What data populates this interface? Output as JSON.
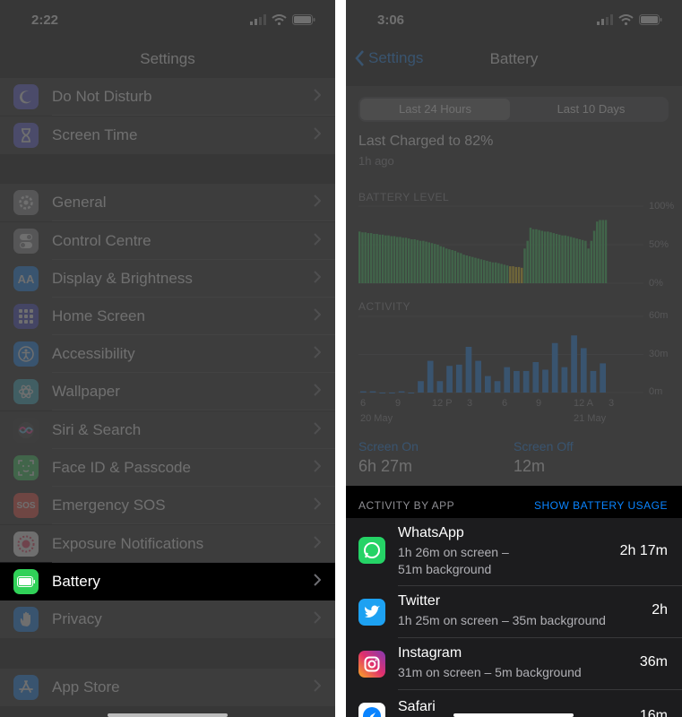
{
  "left": {
    "status_time": "2:22",
    "nav_title": "Settings",
    "items": [
      {
        "label": "Do Not Disturb",
        "icon": "moon-icon",
        "color": "#5e5ce6"
      },
      {
        "label": "Screen Time",
        "icon": "hourglass-icon",
        "color": "#5e5ce6"
      },
      {
        "label": "General",
        "icon": "gear-icon",
        "color": "#8e8e93"
      },
      {
        "label": "Control Centre",
        "icon": "toggles-icon",
        "color": "#8e8e93"
      },
      {
        "label": "Display & Brightness",
        "icon": "text-size-icon",
        "color": "#0a84ff",
        "glyph": "AA"
      },
      {
        "label": "Home Screen",
        "icon": "app-grid-icon",
        "color": "#3d3fce"
      },
      {
        "label": "Accessibility",
        "icon": "accessibility-icon",
        "color": "#0a84ff"
      },
      {
        "label": "Wallpaper",
        "icon": "flower-icon",
        "color": "#30b0c7"
      },
      {
        "label": "Siri & Search",
        "icon": "siri-icon",
        "color": "#222222"
      },
      {
        "label": "Face ID & Passcode",
        "icon": "face-id-icon",
        "color": "#30d158"
      },
      {
        "label": "Emergency SOS",
        "icon": "sos-icon",
        "color": "#ff453a",
        "glyph": "SOS"
      },
      {
        "label": "Exposure Notifications",
        "icon": "exposure-icon",
        "color": "#ffffff"
      },
      {
        "label": "Battery",
        "icon": "battery-icon",
        "color": "#30d158"
      },
      {
        "label": "Privacy",
        "icon": "hand-icon",
        "color": "#0a84ff"
      },
      {
        "label": "App Store",
        "icon": "app-store-icon",
        "color": "#0a84ff"
      }
    ]
  },
  "right": {
    "status_time": "3:06",
    "back_label": "Settings",
    "nav_title": "Battery",
    "segments": [
      "Last 24 Hours",
      "Last 10 Days"
    ],
    "last_charged": "Last Charged to 82%",
    "last_charged_ago": "1h ago",
    "battery_level_label": "BATTERY LEVEL",
    "battery_ticks": [
      "100%",
      "50%",
      "0%"
    ],
    "activity_label": "ACTIVITY",
    "activity_ticks": [
      "60m",
      "30m",
      "0m"
    ],
    "x_ticks": [
      "6",
      "9",
      "12 P",
      "3",
      "6",
      "9",
      "12 A",
      "3"
    ],
    "date_labels": [
      "20 May",
      "21 May"
    ],
    "screen_on_label": "Screen On",
    "screen_on_value": "6h 27m",
    "screen_off_label": "Screen Off",
    "screen_off_value": "12m",
    "activity_by_app": "ACTIVITY BY APP",
    "show_usage": "SHOW BATTERY USAGE",
    "apps": [
      {
        "name": "WhatsApp",
        "desc1": "1h 26m on screen –",
        "desc2": "51m background",
        "time": "2h 17m",
        "icon": "whatsapp-icon"
      },
      {
        "name": "Twitter",
        "desc1": "1h 25m on screen – 35m background",
        "time": "2h",
        "icon": "twitter-icon"
      },
      {
        "name": "Instagram",
        "desc1": "31m on screen – 5m background",
        "time": "36m",
        "icon": "instagram-icon"
      },
      {
        "name": "Safari",
        "time": "16m",
        "icon": "safari-icon"
      }
    ]
  },
  "colors": {
    "accent": "#0a84ff",
    "battery_green": "#30d158",
    "battery_low": "#ffd60a",
    "activity_blue": "#0a84ff"
  },
  "chart_data": [
    {
      "type": "bar",
      "title": "BATTERY LEVEL",
      "ylim": [
        0,
        100
      ],
      "y_tick_labels": [
        "100%",
        "50%",
        "0%"
      ],
      "values": [
        67,
        66,
        66,
        65,
        65,
        64,
        64,
        63,
        63,
        62,
        62,
        61,
        61,
        60,
        60,
        59,
        59,
        58,
        57,
        57,
        56,
        55,
        55,
        54,
        53,
        52,
        51,
        50,
        48,
        47,
        45,
        44,
        43,
        42,
        40,
        39,
        37,
        36,
        35,
        34,
        33,
        32,
        31,
        30,
        29,
        28,
        27,
        27,
        26,
        25,
        24,
        23,
        22,
        22,
        21,
        21,
        20,
        45,
        55,
        72,
        70,
        70,
        69,
        68,
        67,
        67,
        66,
        65,
        64,
        63,
        62,
        62,
        61,
        60,
        59,
        58,
        57,
        56,
        55,
        45,
        55,
        68,
        80,
        82,
        82,
        82
      ]
    },
    {
      "type": "bar",
      "title": "ACTIVITY",
      "ylim": [
        0,
        60
      ],
      "y_tick_labels": [
        "60m",
        "30m",
        "0m"
      ],
      "x_tick_labels": [
        "6",
        "9",
        "12 P",
        "3",
        "6",
        "9",
        "12 A",
        "3"
      ],
      "values": [
        1,
        1,
        0,
        0,
        1,
        0,
        9,
        25,
        9,
        21,
        22,
        36,
        25,
        13,
        9,
        20,
        17,
        17,
        24,
        18,
        39,
        20,
        45,
        35,
        17,
        23
      ]
    }
  ]
}
